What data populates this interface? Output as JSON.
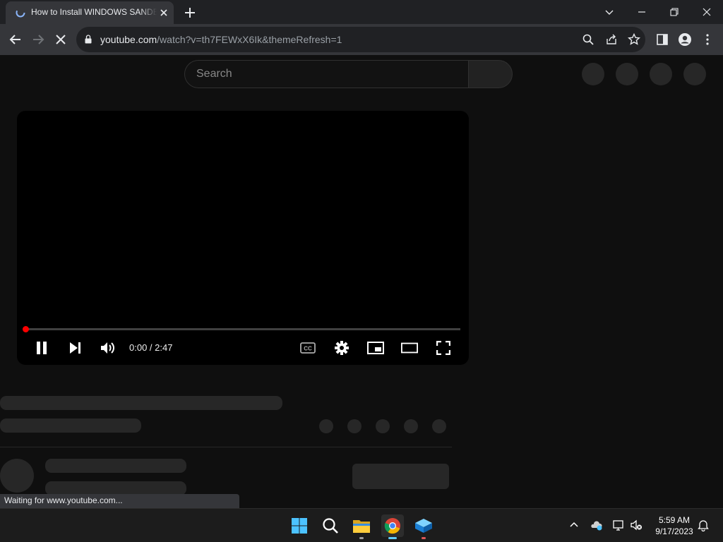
{
  "browser": {
    "tab_title": "How to Install WINDOWS SANDBOX",
    "url_host": "youtube.com",
    "url_path": "/watch?v=th7FEWxX6Ik&themeRefresh=1"
  },
  "youtube": {
    "search_placeholder": "Search",
    "player": {
      "current_time": "0:00",
      "separator": " / ",
      "duration": "2:47",
      "progress": 0
    }
  },
  "status_bar": {
    "text": "Waiting for www.youtube.com..."
  },
  "taskbar": {
    "time": "5:59 AM",
    "date": "9/17/2023",
    "pinned": [
      "start-icon",
      "search-icon",
      "file-explorer-icon",
      "chrome-icon",
      "sandbox-icon"
    ]
  },
  "colors": {
    "youtube_red": "#ff0000",
    "chrome_toolbar": "#35363a",
    "page_background": "#0f0f0f",
    "skeleton": "#272727",
    "taskbar_accent": "#60cdff"
  }
}
